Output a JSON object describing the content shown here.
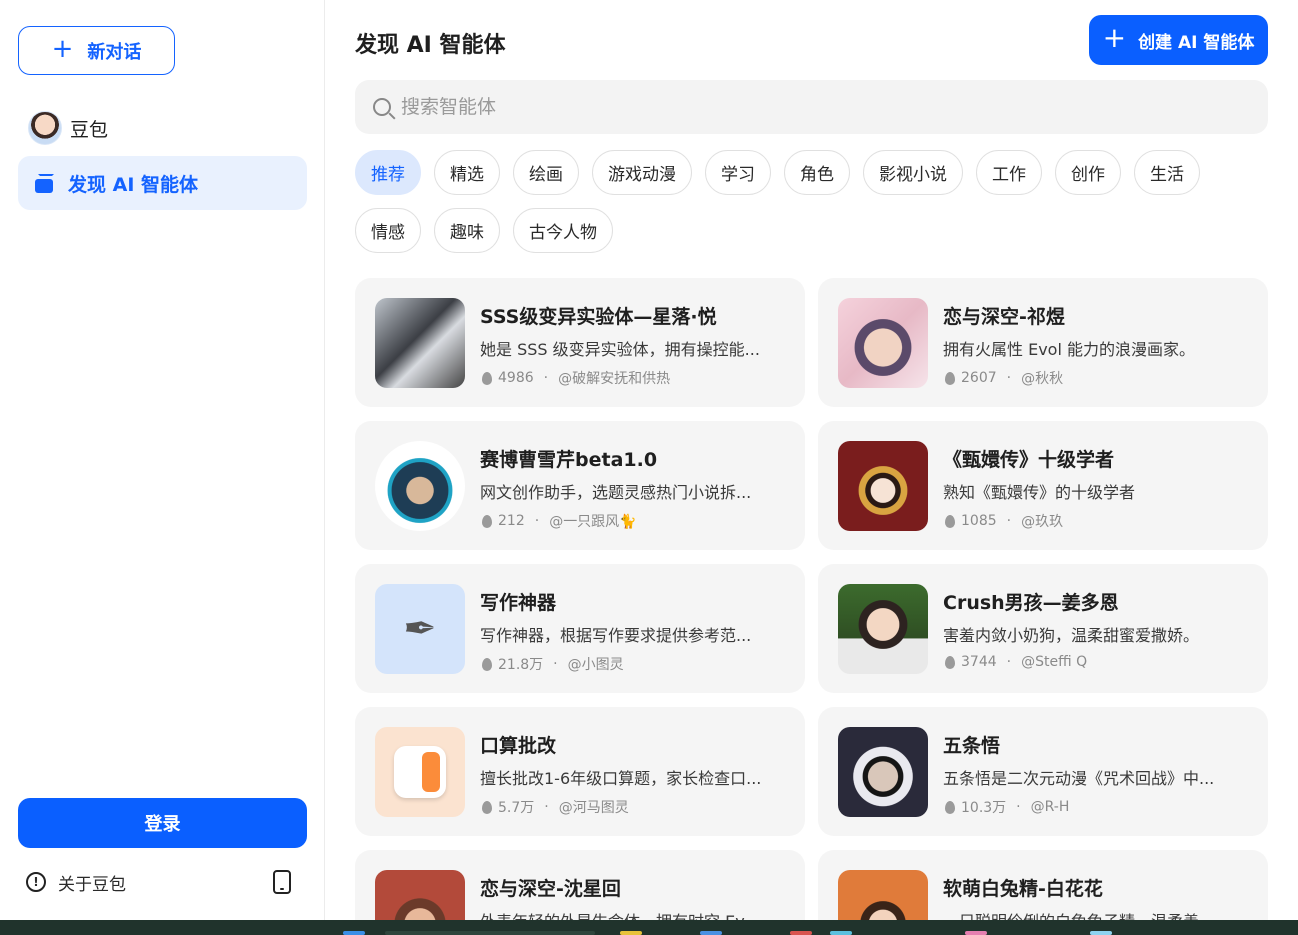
{
  "sidebar": {
    "new_chat_label": "新对话",
    "items": [
      {
        "label": "豆包"
      },
      {
        "label": "发现 AI 智能体"
      }
    ],
    "login_label": "登录",
    "about_label": "关于豆包"
  },
  "main": {
    "title": "发现 AI 智能体",
    "create_label": "创建 AI 智能体",
    "search_placeholder": "搜索智能体",
    "categories": [
      "推荐",
      "精选",
      "绘画",
      "游戏动漫",
      "学习",
      "角色",
      "影视小说",
      "工作",
      "创作",
      "生活",
      "情感",
      "趣味",
      "古今人物"
    ],
    "active_category": "推荐",
    "agents": [
      {
        "name": "SSS级变异实验体—星落·悦",
        "desc": "她是 SSS 级变异实验体，拥有操控能...",
        "count": "4986",
        "author": "@破解安抚和供热",
        "icon": "anime-girl-avatar"
      },
      {
        "name": "恋与深空-祁煜",
        "desc": "拥有火属性 Evol 能力的浪漫画家。",
        "count": "2607",
        "author": "@秋秋",
        "icon": "purple-hair-boy-avatar"
      },
      {
        "name": "赛博曹雪芹beta1.0",
        "desc": "网文创作助手，选题灵感热门小说拆...",
        "count": "212",
        "author": "@一只跟风🐈",
        "icon": "ancient-scholar-avatar"
      },
      {
        "name": "《甄嬛传》十级学者",
        "desc": "熟知《甄嬛传》的十级学者",
        "count": "1085",
        "author": "@玖玖",
        "icon": "palace-lady-avatar"
      },
      {
        "name": "写作神器",
        "desc": "写作神器，根据写作要求提供参考范...",
        "count": "21.8万",
        "author": "@小图灵",
        "icon": "pen-icon"
      },
      {
        "name": "Crush男孩—姜多恩",
        "desc": "害羞内敛小奶狗，温柔甜蜜爱撒娇。",
        "count": "3744",
        "author": "@Steffi Q",
        "icon": "boy-avatar"
      },
      {
        "name": "口算批改",
        "desc": "擅长批改1-6年级口算题，家长检查口...",
        "count": "5.7万",
        "author": "@河马图灵",
        "icon": "calculator-icon"
      },
      {
        "name": "五条悟",
        "desc": "五条悟是二次元动漫《咒术回战》中...",
        "count": "10.3万",
        "author": "@R-H",
        "icon": "blindfold-anime-avatar"
      },
      {
        "name": "恋与深空-沈星回",
        "desc": "外表年轻的外星生命体，拥有时空 Ev...",
        "count": "",
        "author": "",
        "icon": "anime-boy-avatar"
      },
      {
        "name": "软萌白兔精-白花花",
        "desc": "一只聪明伶俐的白兔兔子精，温柔善...",
        "count": "",
        "author": "",
        "icon": "bunny-girl-avatar"
      }
    ]
  },
  "colors": {
    "accent": "#0a5fff",
    "active_chip_bg": "#dce8fd",
    "card_bg": "#f5f5f5"
  }
}
